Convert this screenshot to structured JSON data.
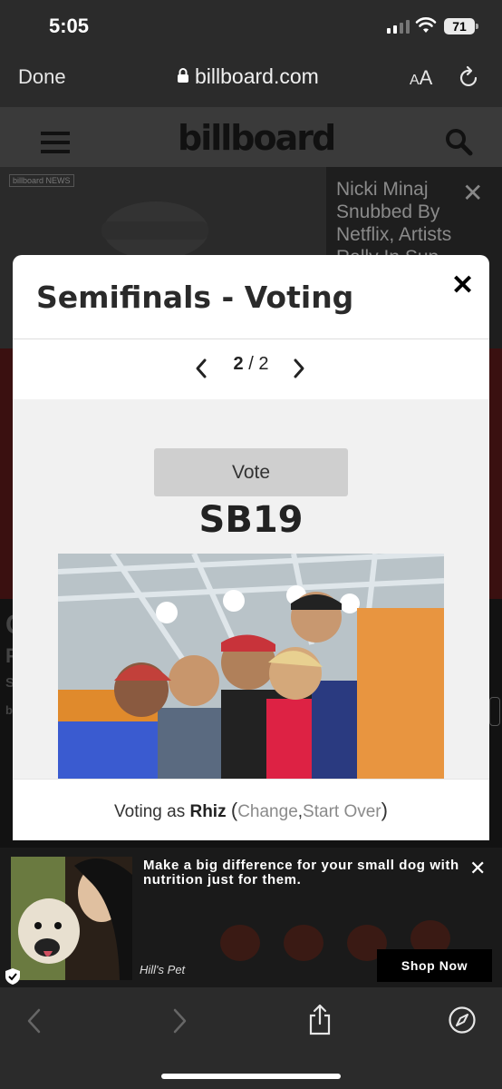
{
  "status_bar": {
    "time": "5:05",
    "battery": "71"
  },
  "safari": {
    "done_label": "Done",
    "url": "billboard.com",
    "text_size_label": "AA"
  },
  "site": {
    "logo": "billboard"
  },
  "background": {
    "news_badge": "billboard NEWS",
    "side_headline": "Nicki Minaj Snubbed By Netflix, Artists Rally In Sup",
    "letters": [
      "C",
      "F",
      "S",
      "b"
    ]
  },
  "modal": {
    "title": "Semifinals - Voting",
    "pager": {
      "current": "2",
      "separator": "/",
      "total": "2"
    },
    "vote_label": "Vote",
    "contestant": "SB19",
    "footer": {
      "prefix": "Voting as",
      "user": "Rhiz",
      "open_paren": "(",
      "change": "Change",
      "comma": ",",
      "start_over": "Start Over",
      "close_paren": ")"
    }
  },
  "ad": {
    "headline": "Make a big difference for your small dog with nutrition just for them.",
    "brand": "Hill's Pet",
    "cta": "Shop Now"
  },
  "icons": [
    "lock-icon",
    "reload-icon",
    "menu-icon",
    "search-icon",
    "close-icon",
    "chevron-left-icon",
    "chevron-right-icon",
    "share-icon",
    "compass-icon"
  ]
}
